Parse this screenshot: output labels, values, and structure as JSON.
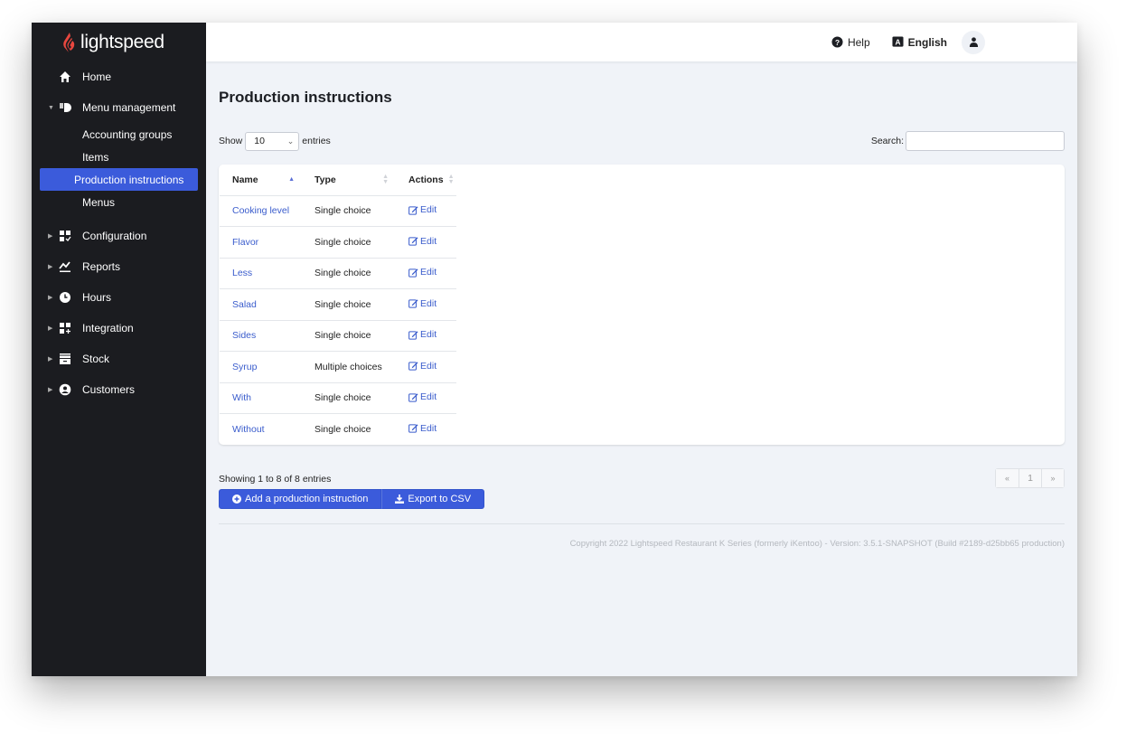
{
  "brand": {
    "name": "lightspeed",
    "accent": "#e8473f"
  },
  "topbar": {
    "help": "Help",
    "language": "English"
  },
  "sidebar": {
    "items": [
      {
        "label": "Home",
        "icon": "home-icon",
        "caret": ""
      },
      {
        "label": "Menu management",
        "icon": "menu-management-icon",
        "caret": "▼",
        "children": [
          {
            "label": "Accounting groups"
          },
          {
            "label": "Items"
          },
          {
            "label": "Production instructions",
            "active": true
          },
          {
            "label": "Menus"
          }
        ]
      },
      {
        "label": "Configuration",
        "icon": "configuration-icon",
        "caret": "▶"
      },
      {
        "label": "Reports",
        "icon": "reports-icon",
        "caret": "▶"
      },
      {
        "label": "Hours",
        "icon": "clock-icon",
        "caret": "▶"
      },
      {
        "label": "Integration",
        "icon": "integration-icon",
        "caret": "▶"
      },
      {
        "label": "Stock",
        "icon": "stock-icon",
        "caret": "▶"
      },
      {
        "label": "Customers",
        "icon": "customer-icon",
        "caret": "▶"
      }
    ]
  },
  "main": {
    "title": "Production instructions",
    "length": {
      "show": "Show",
      "value": "10",
      "entries": "entries"
    },
    "search": {
      "label": "Search:",
      "value": "",
      "placeholder": ""
    },
    "table": {
      "columns": [
        "Name",
        "Type",
        "Actions"
      ],
      "rows": [
        {
          "name": "Cooking level",
          "type": "Single choice",
          "action": "Edit"
        },
        {
          "name": "Flavor",
          "type": "Single choice",
          "action": "Edit"
        },
        {
          "name": "Less",
          "type": "Single choice",
          "action": "Edit"
        },
        {
          "name": "Salad",
          "type": "Single choice",
          "action": "Edit"
        },
        {
          "name": "Sides",
          "type": "Single choice",
          "action": "Edit"
        },
        {
          "name": "Syrup",
          "type": "Multiple choices",
          "action": "Edit"
        },
        {
          "name": "With",
          "type": "Single choice",
          "action": "Edit"
        },
        {
          "name": "Without",
          "type": "Single choice",
          "action": "Edit"
        }
      ]
    },
    "info": "Showing 1 to 8 of 8 entries",
    "pager": {
      "prev": "«",
      "current": "1",
      "next": "»"
    },
    "buttons": {
      "add": "Add a production instruction",
      "export": "Export to CSV"
    },
    "copyright": "Copyright 2022 Lightspeed Restaurant K Series (formerly iKentoo) - Version: 3.5.1-SNAPSHOT (Build #2189-d25bb65 production)"
  }
}
